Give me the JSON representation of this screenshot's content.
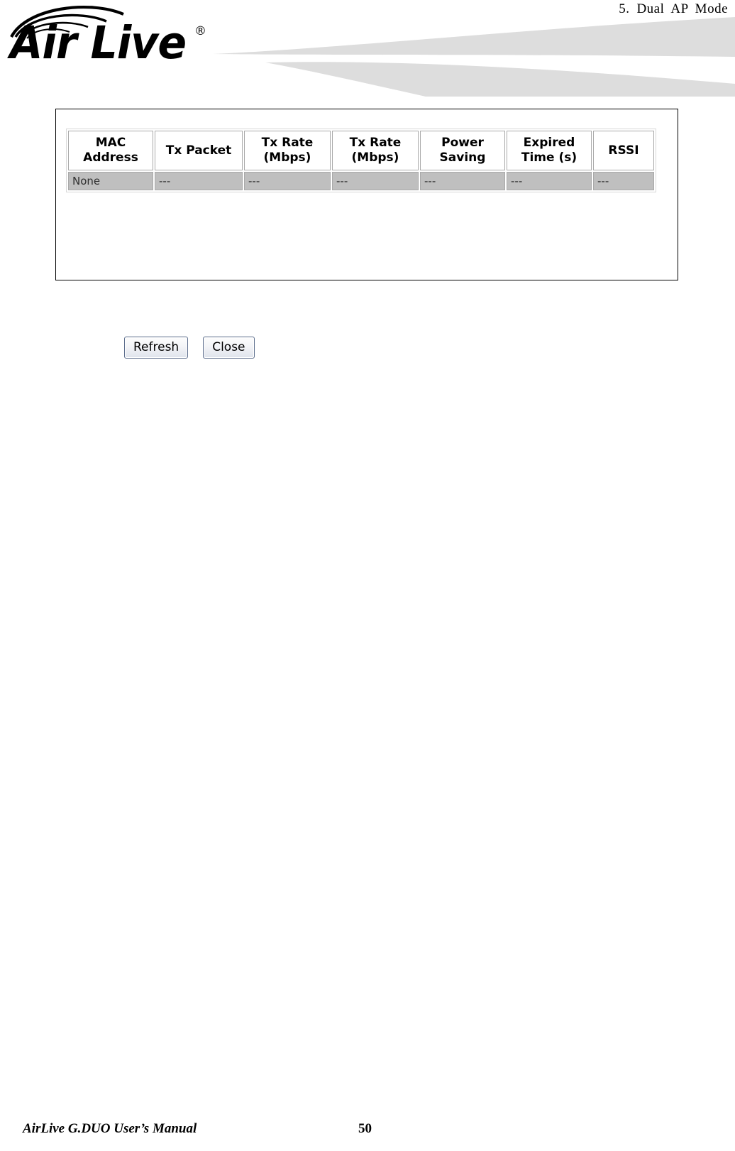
{
  "header": {
    "section_number": "5.",
    "section_title_words": [
      "Dual",
      "AP",
      "Mode"
    ],
    "section_title": "5.   Dual  AP  Mode",
    "logo_text": "Air Live",
    "logo_registered": "®",
    "logo_icon": "wifi-waves-icon",
    "swoosh_color": "#dddddd"
  },
  "panel": {
    "table": {
      "columns": [
        "MAC Address",
        "Tx Packet",
        "Tx Rate (Mbps)",
        "Tx Rate (Mbps)",
        "Power Saving",
        "Expired Time (s)",
        "RSSI"
      ],
      "columns_lines": [
        [
          "MAC",
          "Address"
        ],
        [
          "Tx Packet",
          ""
        ],
        [
          "Tx Rate",
          "(Mbps)"
        ],
        [
          "Tx Rate",
          "(Mbps)"
        ],
        [
          "Power",
          "Saving"
        ],
        [
          "Expired",
          "Time (s)"
        ],
        [
          "RSSI",
          ""
        ]
      ],
      "rows": [
        [
          "None",
          "---",
          "---",
          "---",
          "---",
          "---",
          "---"
        ]
      ],
      "header_bg": "#ffffff",
      "row_bg": "#bfbfbf",
      "border_color": "#a9a9a9"
    },
    "buttons": {
      "refresh_label": "Refresh",
      "close_label": "Close"
    }
  },
  "footer": {
    "manual_title": "AirLive G.DUO User’s Manual",
    "page_number": "50"
  }
}
